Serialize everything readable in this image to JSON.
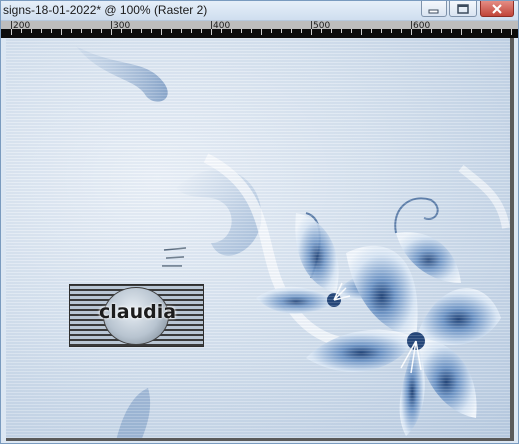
{
  "window": {
    "title": "signs-18-01-2022* @ 100% (Raster 2)"
  },
  "ruler": {
    "labels": [
      "200",
      "300",
      "400",
      "500",
      "600"
    ]
  },
  "watermark": {
    "text": "claudia"
  },
  "colors": {
    "canvas_light": "#eef3f9",
    "canvas_blue": "#b9cbe0",
    "flower_dark": "#1d3f73",
    "close_button": "#c1453a"
  },
  "icons": {
    "minimize": "minimize-icon",
    "maximize": "maximize-icon",
    "close": "close-icon"
  }
}
